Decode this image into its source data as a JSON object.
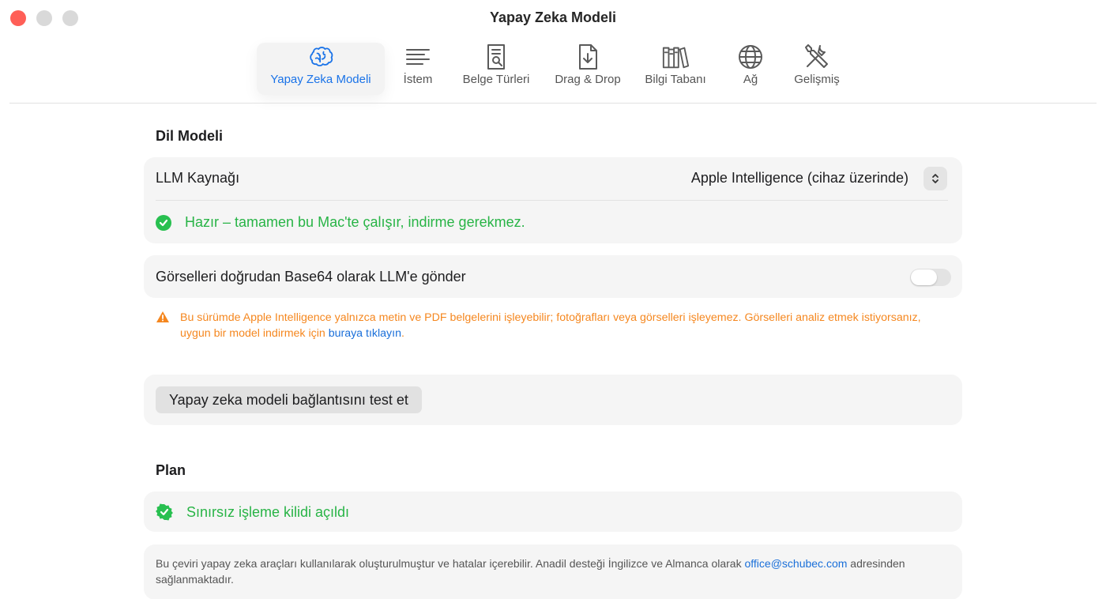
{
  "window": {
    "title": "Yapay Zeka Modeli"
  },
  "toolbar": {
    "tabs": [
      {
        "label": "Yapay Zeka Modeli",
        "icon": "brain-icon",
        "active": true
      },
      {
        "label": "İstem",
        "icon": "text-lines-icon",
        "active": false
      },
      {
        "label": "Belge Türleri",
        "icon": "document-search-icon",
        "active": false
      },
      {
        "label": "Drag & Drop",
        "icon": "document-download-icon",
        "active": false
      },
      {
        "label": "Bilgi Tabanı",
        "icon": "books-icon",
        "active": false
      },
      {
        "label": "Ağ",
        "icon": "globe-icon",
        "active": false
      },
      {
        "label": "Gelişmiş",
        "icon": "tools-icon",
        "active": false
      }
    ]
  },
  "language_model": {
    "title": "Dil Modeli",
    "llm_source_label": "LLM Kaynağı",
    "llm_source_value": "Apple Intelligence (cihaz üzerinde)",
    "status_text": "Hazır – tamamen bu Mac'te çalışır, indirme gerekmez.",
    "send_images_label": "Görselleri doğrudan Base64 olarak LLM'e gönder",
    "send_images_enabled": false,
    "warning_text": "Bu sürümde Apple Intelligence yalnızca metin ve PDF belgelerini işleyebilir; fotoğrafları veya görselleri işleyemez. Görselleri analiz etmek istiyorsanız, uygun bir model indirmek için ",
    "warning_link": "buraya tıklayın",
    "warning_end": ".",
    "test_button": "Yapay zeka modeli bağlantısını test et"
  },
  "plan": {
    "title": "Plan",
    "status_text": "Sınırsız işleme kilidi açıldı"
  },
  "footer_note": {
    "text": "Bu çeviri yapay zeka araçları kullanılarak oluşturulmuştur ve hatalar içerebilir. Anadil desteği İngilizce ve Almanca olarak ",
    "email": "office@schubec.com",
    "text_end": " adresinden sağlanmaktadır."
  },
  "colors": {
    "accent": "#1a73e8",
    "success": "#28b446",
    "warning": "#f5871f",
    "close": "#ff5f57"
  }
}
